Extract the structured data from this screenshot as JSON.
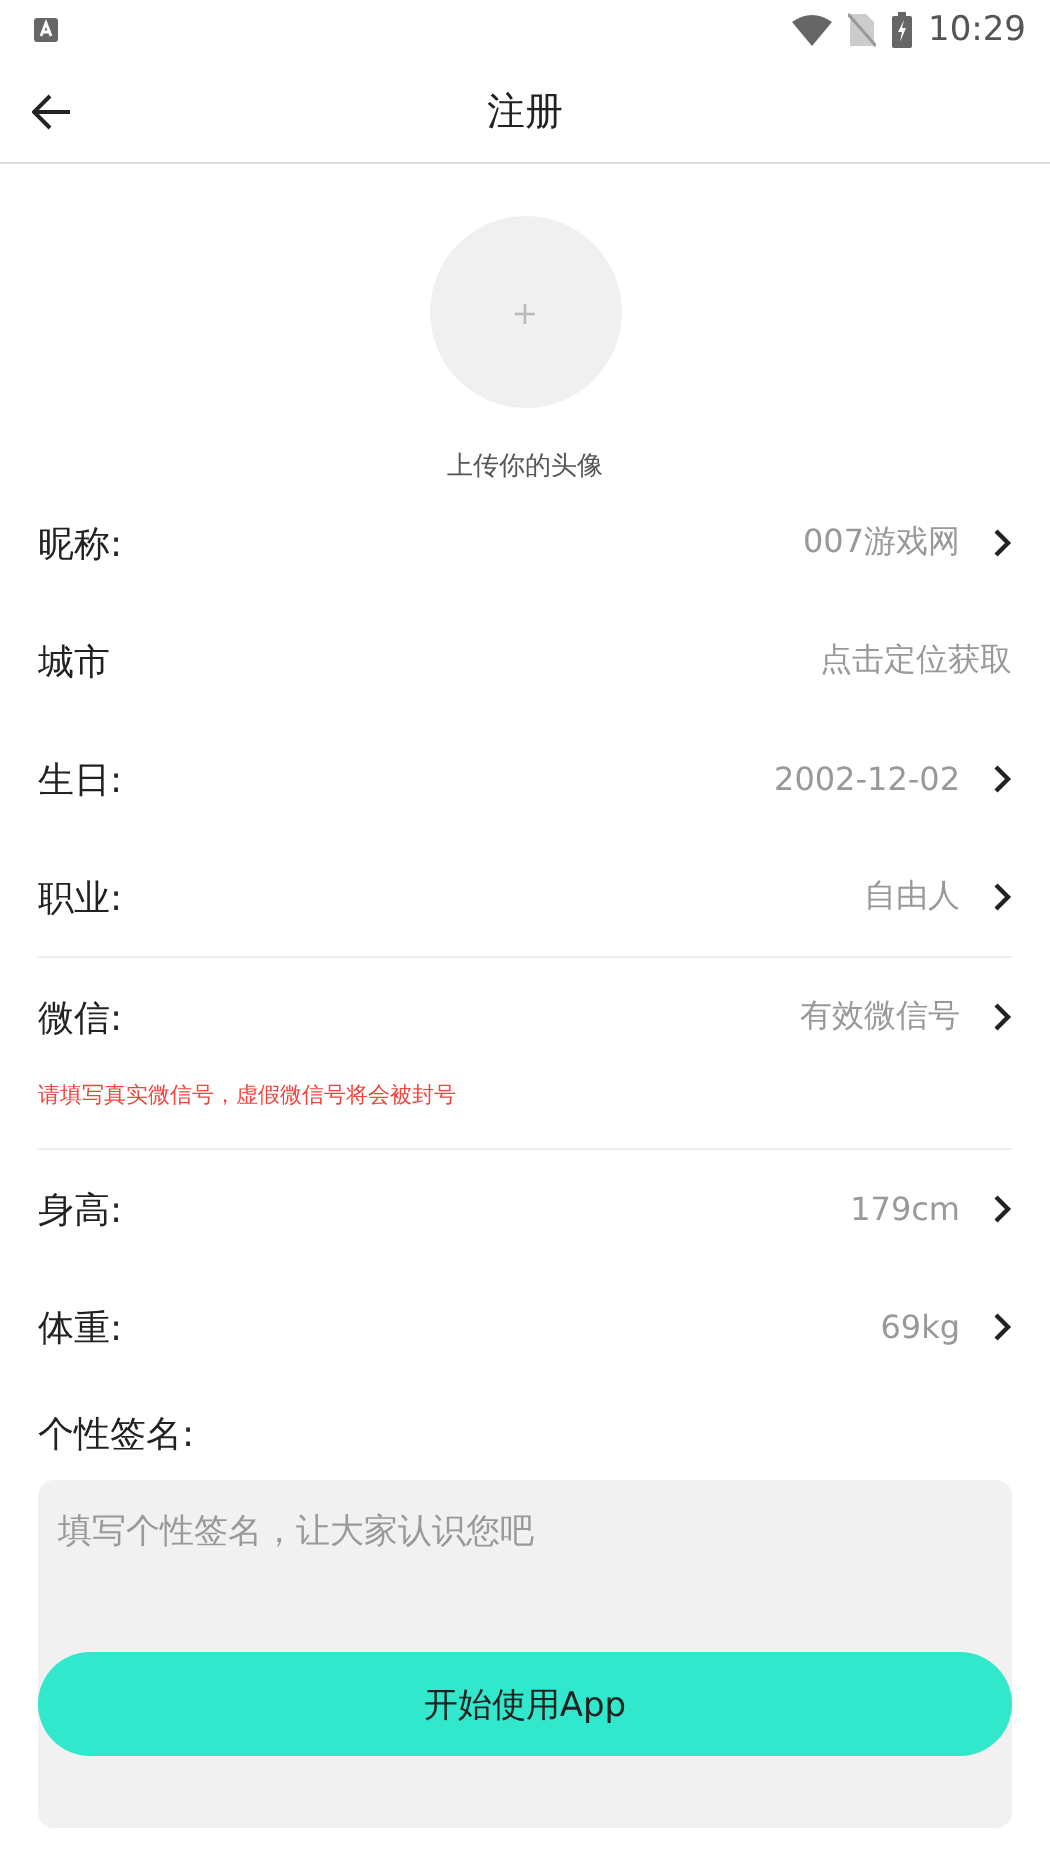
{
  "status_bar": {
    "time": "10:29"
  },
  "header": {
    "title": "注册"
  },
  "avatar": {
    "plus": "+",
    "caption": "上传你的头像"
  },
  "rows": [
    {
      "label": "昵称:",
      "value": "007游戏网",
      "chevron": true
    },
    {
      "label": "城市",
      "value": "点击定位获取",
      "chevron": false
    },
    {
      "label": "生日:",
      "value": "2002-12-02",
      "chevron": true
    },
    {
      "label": "职业:",
      "value": "自由人",
      "chevron": true
    },
    {
      "label": "微信:",
      "value": "有效微信号",
      "chevron": true,
      "note": "请填写真实微信号，虚假微信号将会被封号"
    },
    {
      "label": "身高:",
      "value": "179cm",
      "chevron": true
    },
    {
      "label": "体重:",
      "value": "69kg",
      "chevron": true
    }
  ],
  "signature": {
    "label": "个性签名:",
    "placeholder": "填写个性签名，让大家认识您吧"
  },
  "submit": "开始使用App"
}
